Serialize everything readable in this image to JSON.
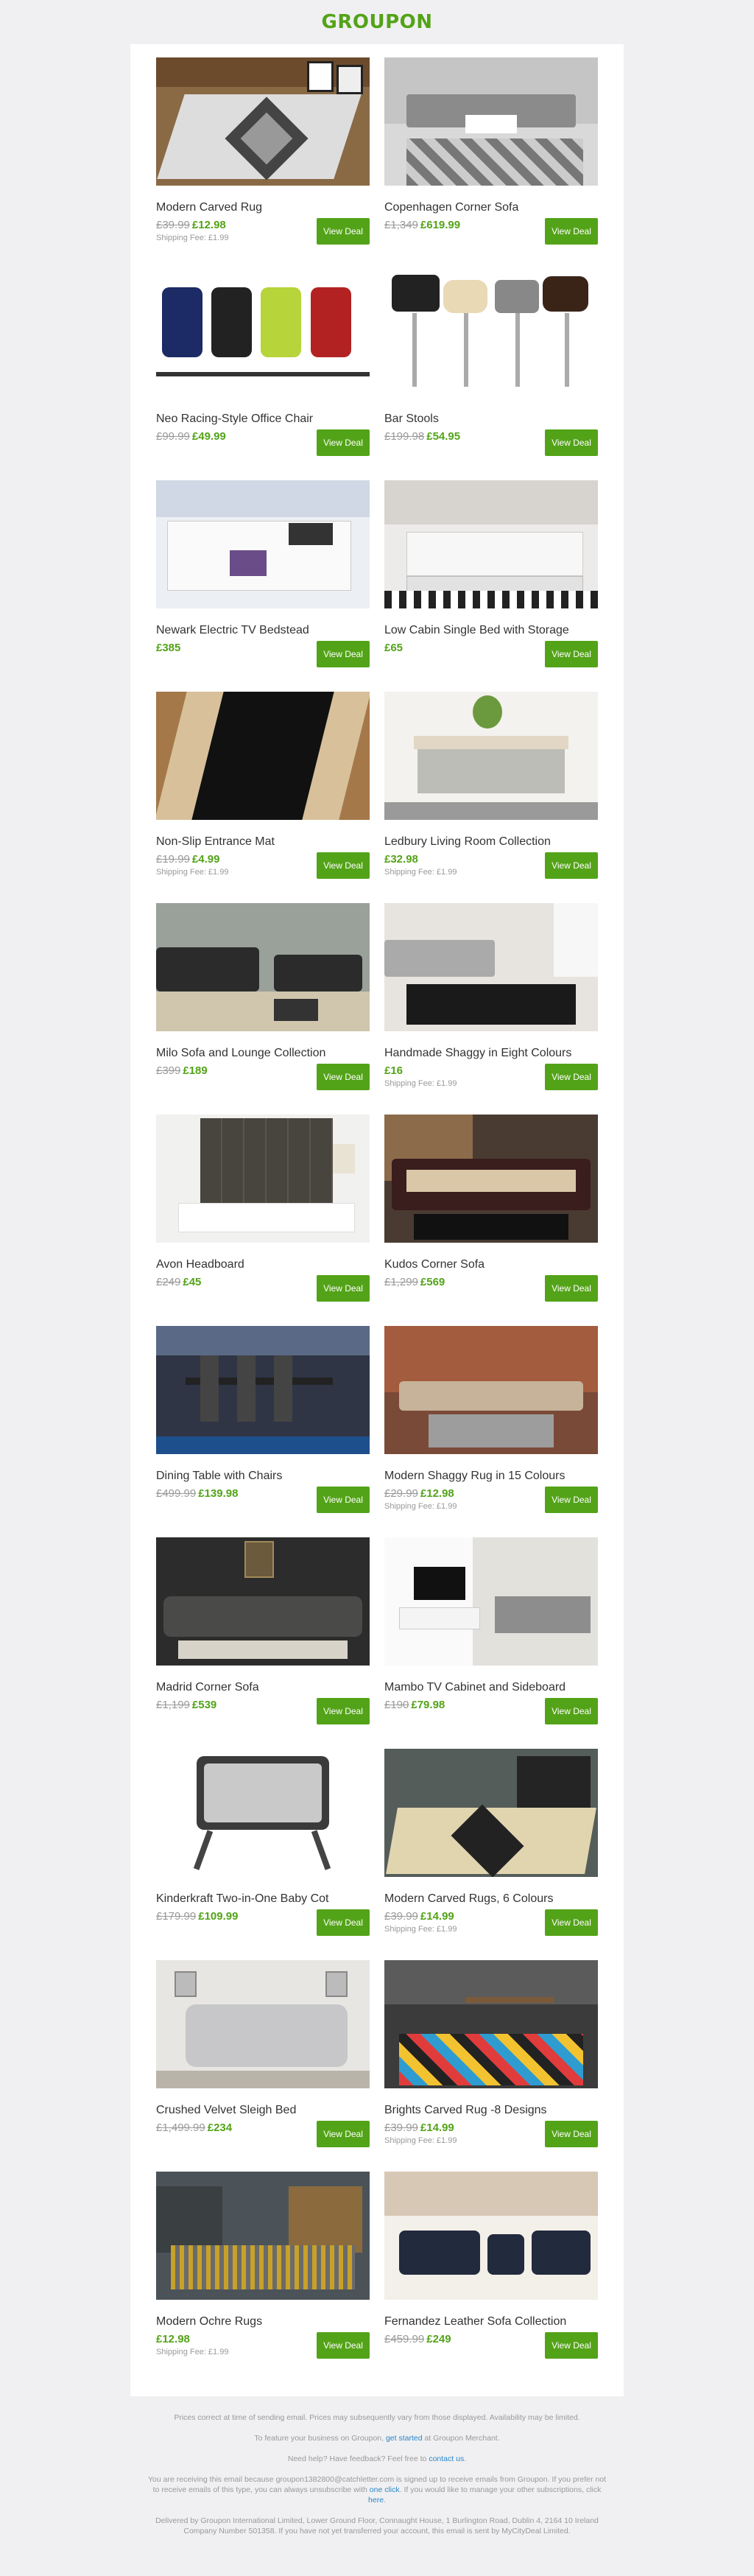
{
  "brand": "GROUPON",
  "colors": {
    "accent": "#53a318",
    "link": "#2a86c8"
  },
  "button_label": "View Deal",
  "deals": [
    {
      "title": "Modern Carved Rug",
      "old": "£39.99",
      "new": "£12.98",
      "ship": "Shipping Fee: £1.99"
    },
    {
      "title": "Copenhagen Corner Sofa",
      "old": "£1,349",
      "new": "£619.99",
      "ship": ""
    },
    {
      "title": "Neo Racing-Style Office Chair",
      "old": "£99.99",
      "new": "£49.99",
      "ship": ""
    },
    {
      "title": "Bar Stools",
      "old": "£199.98",
      "new": "£54.95",
      "ship": ""
    },
    {
      "title": "Newark Electric TV Bedstead",
      "old": "",
      "new": "£385",
      "ship": ""
    },
    {
      "title": "Low Cabin Single Bed with Storage",
      "old": "",
      "new": "£65",
      "ship": ""
    },
    {
      "title": "Non-Slip Entrance Mat",
      "old": "£19.99",
      "new": "£4.99",
      "ship": "Shipping Fee: £1.99"
    },
    {
      "title": "Ledbury Living Room Collection",
      "old": "",
      "new": "£32.98",
      "ship": "Shipping Fee: £1.99"
    },
    {
      "title": "Milo Sofa and Lounge Collection",
      "old": "£399",
      "new": "£189",
      "ship": ""
    },
    {
      "title": "Handmade Shaggy in Eight Colours",
      "old": "",
      "new": "£16",
      "ship": "Shipping Fee: £1.99"
    },
    {
      "title": "Avon Headboard",
      "old": "£249",
      "new": "£45",
      "ship": ""
    },
    {
      "title": "Kudos Corner Sofa",
      "old": "£1,299",
      "new": "£569",
      "ship": ""
    },
    {
      "title": "Dining Table with Chairs",
      "old": "£499.99",
      "new": "£139.98",
      "ship": ""
    },
    {
      "title": "Modern Shaggy Rug in 15 Colours",
      "old": "£29.99",
      "new": "£12.98",
      "ship": "Shipping Fee: £1.99"
    },
    {
      "title": "Madrid Corner Sofa",
      "old": "£1,199",
      "new": "£539",
      "ship": ""
    },
    {
      "title": "Mambo TV Cabinet and Sideboard",
      "old": "£190",
      "new": "£79.98",
      "ship": ""
    },
    {
      "title": "Kinderkraft Two-in-One Baby Cot",
      "old": "£179.99",
      "new": "£109.99",
      "ship": ""
    },
    {
      "title": "Modern Carved Rugs, 6 Colours",
      "old": "£39.99",
      "new": "£14.99",
      "ship": "Shipping Fee: £1.99"
    },
    {
      "title": "Crushed Velvet Sleigh Bed",
      "old": "£1,499.99",
      "new": "£234",
      "ship": ""
    },
    {
      "title": "Brights Carved Rug -8 Designs",
      "old": "£39.99",
      "new": "£14.99",
      "ship": "Shipping Fee: £1.99"
    },
    {
      "title": "Modern Ochre Rugs",
      "old": "",
      "new": "£12.98",
      "ship": "Shipping Fee: £1.99"
    },
    {
      "title": "Fernandez Leather Sofa Collection",
      "old": "£459.99",
      "new": "£249",
      "ship": ""
    }
  ],
  "footer": {
    "prices_note": "Prices correct at time of sending email. Prices may subsequently vary from those displayed. Availability may be limited.",
    "merchant_pre": "To feature your business on Groupon, ",
    "merchant_link": "get started",
    "merchant_post": " at Groupon Merchant.",
    "help_pre": "Need help? Have feedback? Feel free to ",
    "help_link": "contact us",
    "help_post": ".",
    "reason_pre": "You are receiving this email because groupon1382800@catchletter.com is signed up to receive emails from Groupon. If you prefer not to receive emails of this type, you can always unsubscribe with ",
    "reason_link": "one click",
    "reason_mid": ". If you would like to manage your other subscriptions, click ",
    "reason_link2": "here",
    "reason_post": ".",
    "legal": "Delivered by Groupon International Limited, Lower Ground Floor, Connaught House, 1 Burlington Road, Dublin 4, 2164 10 Ireland Company Number 501358. If you have not yet transferred your account, this email is sent by MyCityDeal Limited."
  }
}
